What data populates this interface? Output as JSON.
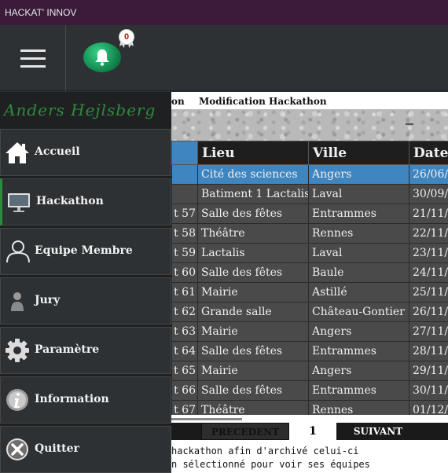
{
  "window": {
    "title": "HACKAT' INNOV"
  },
  "notifications": {
    "count": "0"
  },
  "user": {
    "name": "Anders Hejlsberg"
  },
  "sidebar": {
    "items": [
      {
        "label": "Accueil",
        "icon": "home-icon"
      },
      {
        "label": "Hackathon",
        "icon": "monitor-icon"
      },
      {
        "label": "Equipe Membre",
        "icon": "user-icon"
      },
      {
        "label": "Jury",
        "icon": "person-icon"
      },
      {
        "label": "Paramètre",
        "icon": "gear-icon"
      },
      {
        "label": "Information",
        "icon": "info-icon"
      },
      {
        "label": "Quitter",
        "icon": "close-icon"
      }
    ]
  },
  "breadcrumb": {
    "partial": "on",
    "current": "Modification Hackathon"
  },
  "table": {
    "columns": [
      "",
      "Lieu",
      "Ville",
      "Date"
    ],
    "rows": [
      [
        "",
        "Cité des sciences",
        "Angers",
        "26/06/"
      ],
      [
        "",
        "Batiment 1 Lactalis",
        "Laval",
        "30/09/"
      ],
      [
        "t 57",
        "Salle des fêtes",
        "Entrammes",
        "21/11/"
      ],
      [
        "t 58",
        "Théâtre",
        "Rennes",
        "22/11/"
      ],
      [
        "t 59",
        "Lactalis",
        "Laval",
        "23/11/"
      ],
      [
        "t 60",
        "Salle des fêtes",
        "Baule",
        "24/11/"
      ],
      [
        "t 61",
        "Mairie",
        "Astillé",
        "25/11/"
      ],
      [
        "t 62",
        "Grande salle",
        "Château-Gontier",
        "26/11/"
      ],
      [
        "t 63",
        "Mairie",
        "Angers",
        "27/11/"
      ],
      [
        "t 64",
        "Salle des fêtes",
        "Entrammes",
        "28/11/"
      ],
      [
        "t 65",
        "Mairie",
        "Angers",
        "29/11/"
      ],
      [
        "t 66",
        "Salle des fêtes",
        "Entrammes",
        "30/11/"
      ],
      [
        "t 67",
        "Théâtre",
        "Rennes",
        "01/12/"
      ]
    ],
    "selected_row": 0
  },
  "pager": {
    "prev_label": "PRECEDENT",
    "page": "1",
    "next_label": "SUIVANT"
  },
  "help": {
    "line1": "hackathon afin d'archivé celui-ci",
    "line2": "n sélectionné pour voir ses équipes"
  },
  "colors": {
    "accent": "#3f85c0",
    "brand_green": "#2e8b3e",
    "titlebar": "#3a1b3a"
  }
}
